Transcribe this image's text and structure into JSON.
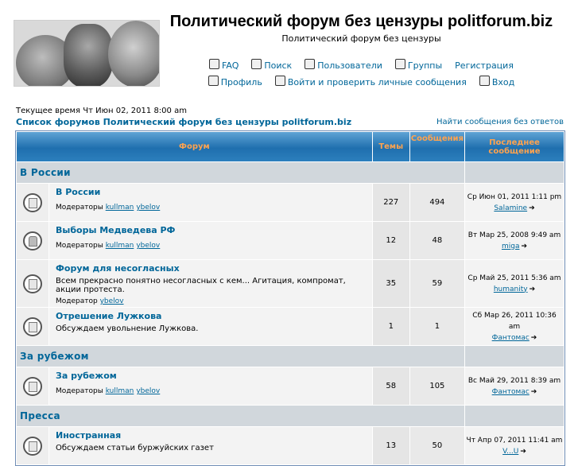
{
  "header": {
    "site_title": "Политический форум без цензуры politforum.biz",
    "site_description": "Политический форум без цензуры",
    "menu_row1": [
      {
        "label": "FAQ",
        "icon": "faq-icon"
      },
      {
        "label": "Поиск",
        "icon": "search-icon"
      },
      {
        "label": "Пользователи",
        "icon": "users-icon"
      },
      {
        "label": "Группы",
        "icon": "groups-icon"
      },
      {
        "label": "Регистрация",
        "icon": ""
      }
    ],
    "menu_row2": [
      {
        "label": "Профиль",
        "icon": "profile-icon"
      },
      {
        "label": "Войти и проверить личные сообщения",
        "icon": "messages-icon"
      },
      {
        "label": "Вход",
        "icon": "login-icon"
      }
    ]
  },
  "current_time": "Текущее время Чт Июн 02, 2011 8:00 am",
  "breadcrumb": "Список форумов Политический форум без цензуры politforum.biz",
  "unanswered_link": "Найти сообщения без ответов",
  "table": {
    "headers": {
      "forum": "Форум",
      "topics": "Темы",
      "posts": "Сообщения",
      "last_post": "Последнее сообщение"
    },
    "categories": [
      {
        "name": "В России",
        "forums": [
          {
            "name": "В России",
            "description": "",
            "mod_label": "Модераторы",
            "moderators": [
              "kullman",
              "ybelov"
            ],
            "topics": "227",
            "posts": "494",
            "last_date": "Ср Июн 01, 2011 1:11 pm",
            "last_user": "Salamine",
            "locked": false
          },
          {
            "name": "Выборы Медведева РФ",
            "description": "",
            "mod_label": "Модераторы",
            "moderators": [
              "kullman",
              "ybelov"
            ],
            "topics": "12",
            "posts": "48",
            "last_date": "Вт Мар 25, 2008 9:49 am",
            "last_user": "miga",
            "locked": true
          },
          {
            "name": "Форум для несогласных",
            "description": "Всем прекрасно понятно несогласных с кем... Агитация, компромат, акции протеста.",
            "mod_label": "Модератор",
            "moderators": [
              "ybelov"
            ],
            "topics": "35",
            "posts": "59",
            "last_date": "Ср Май 25, 2011 5:36 am",
            "last_user": "humanity",
            "locked": false
          },
          {
            "name": "Отрешение Лужкова",
            "description": "Обсуждаем увольнение Лужкова.",
            "mod_label": "",
            "moderators": [],
            "topics": "1",
            "posts": "1",
            "last_date": "Сб Мар 26, 2011 10:36 am",
            "last_user": "Фантомас",
            "locked": false
          }
        ]
      },
      {
        "name": "За рубежом",
        "forums": [
          {
            "name": "За рубежом",
            "description": "",
            "mod_label": "Модераторы",
            "moderators": [
              "kullman",
              "ybelov"
            ],
            "topics": "58",
            "posts": "105",
            "last_date": "Вс Май 29, 2011 8:39 am",
            "last_user": "Фантомас",
            "locked": false
          }
        ]
      },
      {
        "name": "Пресса",
        "forums": [
          {
            "name": "Иностранная",
            "description": "Обсуждаем статьи буржуйских газет",
            "mod_label": "",
            "moderators": [],
            "topics": "13",
            "posts": "50",
            "last_date": "Чт Апр 07, 2011 11:41 am",
            "last_user": "V...U",
            "locked": false
          }
        ]
      }
    ]
  }
}
